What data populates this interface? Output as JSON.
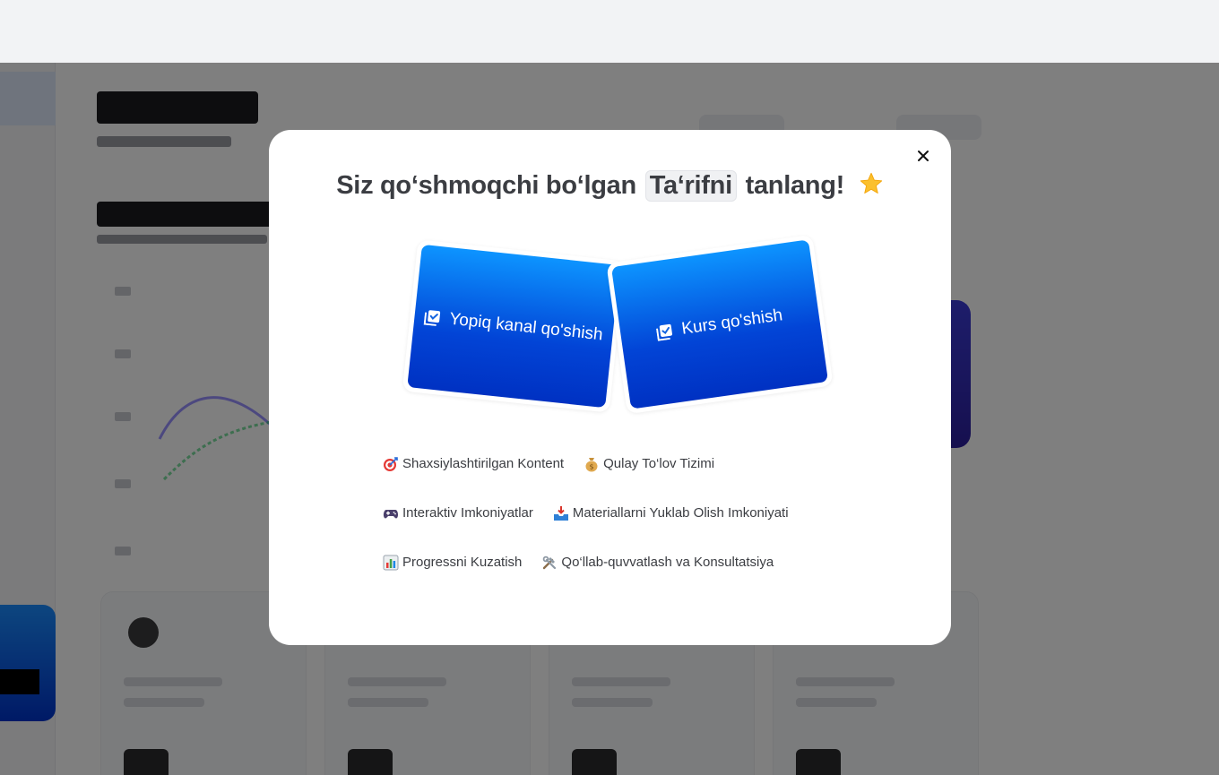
{
  "modal": {
    "title_before": "Siz qo‘shmoqchi bo‘lgan",
    "title_highlight": "Ta‘rifni",
    "title_after": "tanlang!",
    "options": [
      {
        "label": "Yopiq kanal qo'shish",
        "icon": "checklist-icon"
      },
      {
        "label": "Kurs qo'shish",
        "icon": "checklist-icon"
      }
    ],
    "features": [
      {
        "label": "Shaxsiylashtirilgan Kontent",
        "icon": "target-icon"
      },
      {
        "label": "Qulay To‘lov Tizimi",
        "icon": "money-bag-icon"
      },
      {
        "label": "Interaktiv Imkoniyatlar",
        "icon": "game-controller-icon"
      },
      {
        "label": "Materiallarni Yuklab Olish Imkoniyati",
        "icon": "inbox-tray-icon"
      },
      {
        "label": "Progressni Kuzatish",
        "icon": "bar-chart-icon"
      },
      {
        "label": "Qo‘llab-quvvatlash va Konsultatsiya",
        "icon": "tools-icon"
      }
    ]
  },
  "colors": {
    "accent_top": "#0d94ff",
    "accent_bottom": "#0031c2",
    "overlay": "rgba(0,0,0,0.5)",
    "title_text": "#3b3d42"
  }
}
